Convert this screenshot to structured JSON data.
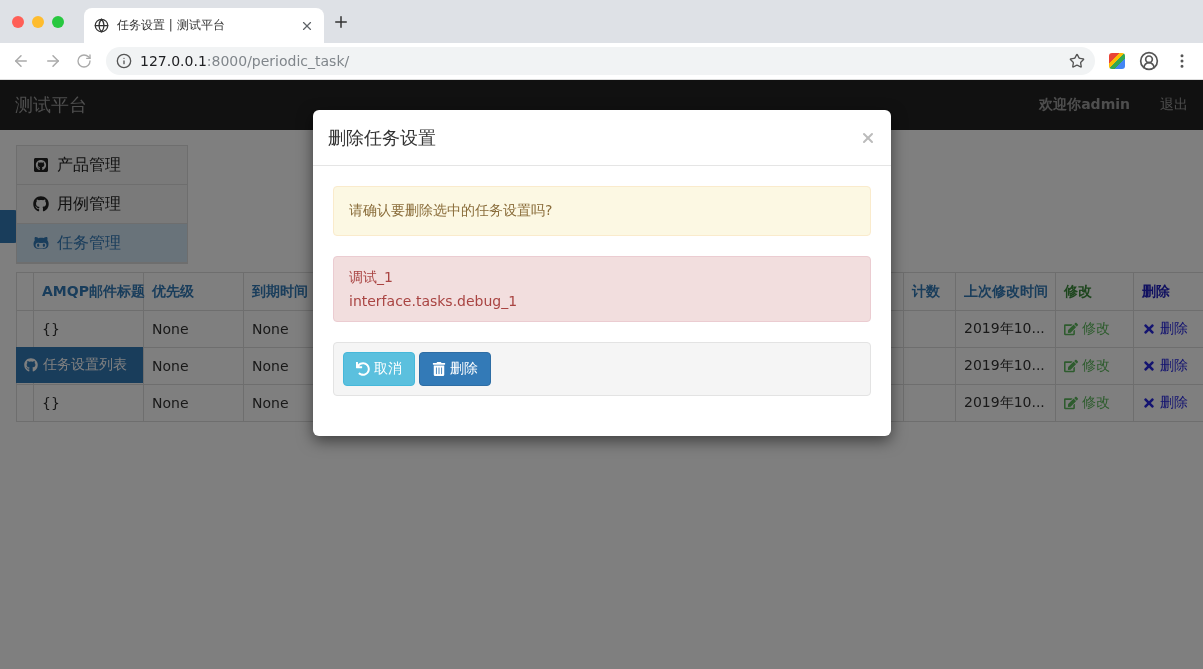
{
  "browser": {
    "tab_title": "任务设置 | 测试平台",
    "url_host": "127.0.0.1",
    "url_path": ":8000/periodic_task/"
  },
  "navbar": {
    "brand": "测试平台",
    "user": "欢迎你admin",
    "logout": "退出"
  },
  "side_menu": {
    "items": [
      {
        "label": "产品管理",
        "selected": false
      },
      {
        "label": "用例管理",
        "selected": false
      },
      {
        "label": "任务管理",
        "selected": true
      }
    ],
    "submenu": [
      {
        "label": "任务设置列表",
        "selected": true
      }
    ]
  },
  "table": {
    "columns": [
      {
        "label": "AMQP邮件标题",
        "kind": "text"
      },
      {
        "label": "优先级",
        "kind": "text"
      },
      {
        "label": "到期时间",
        "kind": "text"
      },
      {
        "label": "计数",
        "kind": "text"
      },
      {
        "label": "上次修改时间",
        "kind": "text"
      },
      {
        "label": "修改",
        "kind": "edit"
      },
      {
        "label": "删除",
        "kind": "delete"
      }
    ],
    "rows": [
      {
        "cells": [
          "{}",
          "None",
          "None",
          null,
          "2019年10...",
          "修改",
          "删除"
        ]
      },
      {
        "cells": [
          null,
          "None",
          "None",
          null,
          "2019年10...",
          "修改",
          "删除"
        ]
      },
      {
        "cells": [
          "{}",
          "None",
          "None",
          null,
          "2019年10...",
          "修改",
          "删除"
        ]
      }
    ]
  },
  "modal": {
    "title": "删除任务设置",
    "warning": "请确认要删除选中的任务设置吗?",
    "items": [
      "调试_1",
      "interface.tasks.debug_1"
    ],
    "cancel": "取消",
    "confirm": "删除"
  }
}
